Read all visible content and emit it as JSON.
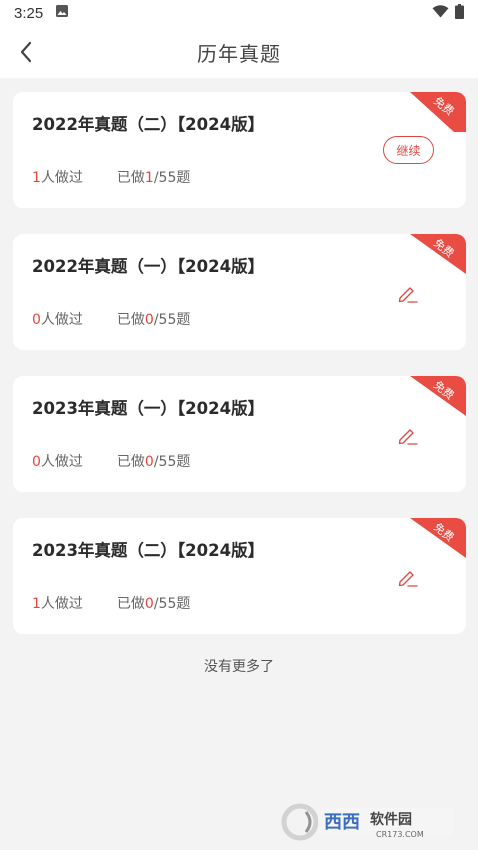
{
  "status_bar": {
    "time": "3:25"
  },
  "header": {
    "title": "历年真题"
  },
  "cards": [
    {
      "title": "2022年真题（二）【2024版】",
      "people_count": "1",
      "people_suffix": "人做过",
      "done_prefix": "已做",
      "done_count": "1",
      "done_total": "/55题",
      "badge": "免费",
      "action": "继续"
    },
    {
      "title": "2022年真题（一）【2024版】",
      "people_count": "0",
      "people_suffix": "人做过",
      "done_prefix": "已做",
      "done_count": "0",
      "done_total": "/55题",
      "badge": "免费",
      "action_icon": "edit-icon"
    },
    {
      "title": "2023年真题（一）【2024版】",
      "people_count": "0",
      "people_suffix": "人做过",
      "done_prefix": "已做",
      "done_count": "0",
      "done_total": "/55题",
      "badge": "免费",
      "action_icon": "edit-icon"
    },
    {
      "title": "2023年真题（二）【2024版】",
      "people_count": "1",
      "people_suffix": "人做过",
      "done_prefix": "已做",
      "done_count": "0",
      "done_total": "/55题",
      "badge": "免费",
      "action_icon": "edit-icon"
    }
  ],
  "footer": {
    "no_more": "没有更多了"
  },
  "watermark": {
    "text": "西西软件园",
    "url_text": "CR173.COM"
  },
  "colors": {
    "accent": "#e0463f",
    "background": "#f3f3f3"
  }
}
